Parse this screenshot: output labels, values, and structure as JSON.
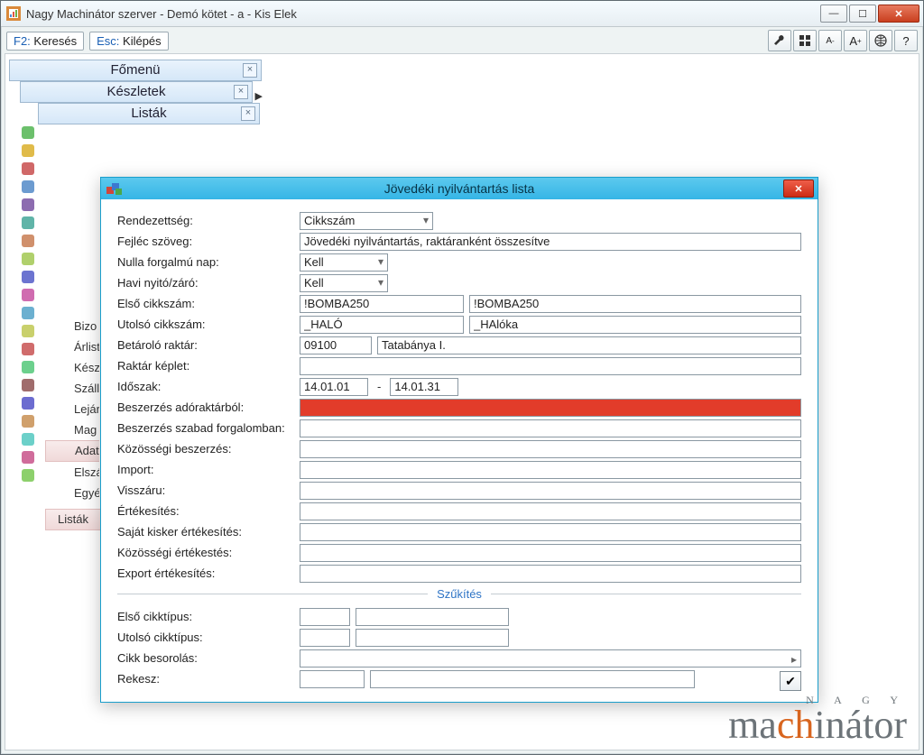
{
  "window": {
    "title": "Nagy Machinátor szerver - Demó kötet - a - Kis Elek"
  },
  "shortcuts": {
    "f2_key": "F2:",
    "f2_label": " Keresés",
    "esc_key": "Esc:",
    "esc_label": " Kilépés"
  },
  "toolbar_icons": {
    "wrench": "wrench",
    "grid": "grid",
    "font_minus": "A-",
    "font_plus": "A+",
    "globe": "globe",
    "help": "?"
  },
  "tabs": {
    "t1": "Főmenü",
    "t2": "Készletek",
    "t3": "Listák"
  },
  "peek": {
    "i0": "Bizo",
    "i1": "Árlist",
    "i2": "Kész",
    "i3": "Szálli",
    "i4": "Lejár",
    "i5": "Mag",
    "i6": "Adat",
    "i7": "Elszámo",
    "i8": "Egyéb f",
    "bottom": "Listák"
  },
  "dialog": {
    "title": "Jövedéki nyilvántartás lista"
  },
  "form": {
    "rendezettseg": {
      "label": "Rendezettség:",
      "value": "Cikkszám"
    },
    "fejlec": {
      "label": "Fejléc szöveg:",
      "value": "Jövedéki nyilvántartás, raktáranként összesítve"
    },
    "nulla_nap": {
      "label": "Nulla forgalmú nap:",
      "value": "Kell"
    },
    "havi": {
      "label": "Havi nyitó/záró:",
      "value": "Kell"
    },
    "elso_cikk": {
      "label": "Első cikkszám:",
      "a": "!BOMBA250",
      "b": "!BOMBA250"
    },
    "utolso_cikk": {
      "label": "Utolsó cikkszám:",
      "a": "_HALÓ",
      "b": "_HAlóka"
    },
    "betarolo": {
      "label": "Betároló raktár:",
      "code": "09100",
      "name": "Tatabánya I."
    },
    "raktar_keplet": {
      "label": "Raktár képlet:",
      "value": ""
    },
    "idoszak": {
      "label": "Időszak:",
      "from": "14.01.01",
      "to": "14.01.31"
    },
    "besz_adoraktar": {
      "label": "Beszerzés adóraktárból:"
    },
    "besz_szabad": {
      "label": "Beszerzés szabad forgalomban:"
    },
    "koz_beszerzes": {
      "label": "Közösségi beszerzés:"
    },
    "import": {
      "label": "Import:"
    },
    "visszaru": {
      "label": "Visszáru:"
    },
    "ertekesites": {
      "label": "Értékesítés:"
    },
    "sajat_kisker": {
      "label": "Saját kisker értékesítés:"
    },
    "koz_ertekesites": {
      "label": "Közösségi értékestés:"
    },
    "export_ert": {
      "label": "Export értékesítés:"
    },
    "szukites": "Szűkítés",
    "elso_cikktipus": {
      "label": "Első cikktípus:"
    },
    "utolso_cikktipus": {
      "label": "Utolsó cikktípus:"
    },
    "cikk_besorolas": {
      "label": "Cikk besorolás:"
    },
    "rekesz": {
      "label": "Rekesz:"
    }
  },
  "brand": {
    "top": "N A G Y",
    "main_pre": "ma",
    "main_accent": "ch",
    "main_post": "inátor"
  }
}
